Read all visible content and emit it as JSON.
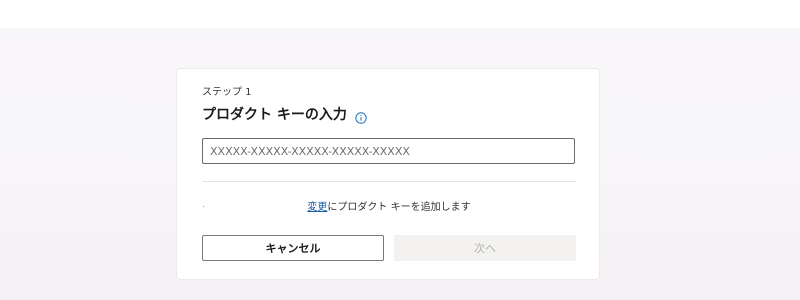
{
  "dialog": {
    "step_label": "ステップ 1",
    "title": "プロダクト キーの入力",
    "info_icon": "info-circle-icon",
    "key_input": {
      "value": "",
      "placeholder": "XXXXX-XXXXX-XXXXX-XXXXX-XXXXX"
    },
    "add_key": {
      "link_text": "変更",
      "suffix_text": "にプロダクト キーを追加します"
    },
    "buttons": {
      "cancel_label": "キャンセル",
      "next_label": "次へ",
      "next_enabled": false
    }
  },
  "colors": {
    "accent_link": "#1a5aa6",
    "info_icon": "#1a6fbf",
    "disabled_button_bg": "#f3f2f1",
    "disabled_button_text": "#b3b3b3"
  }
}
